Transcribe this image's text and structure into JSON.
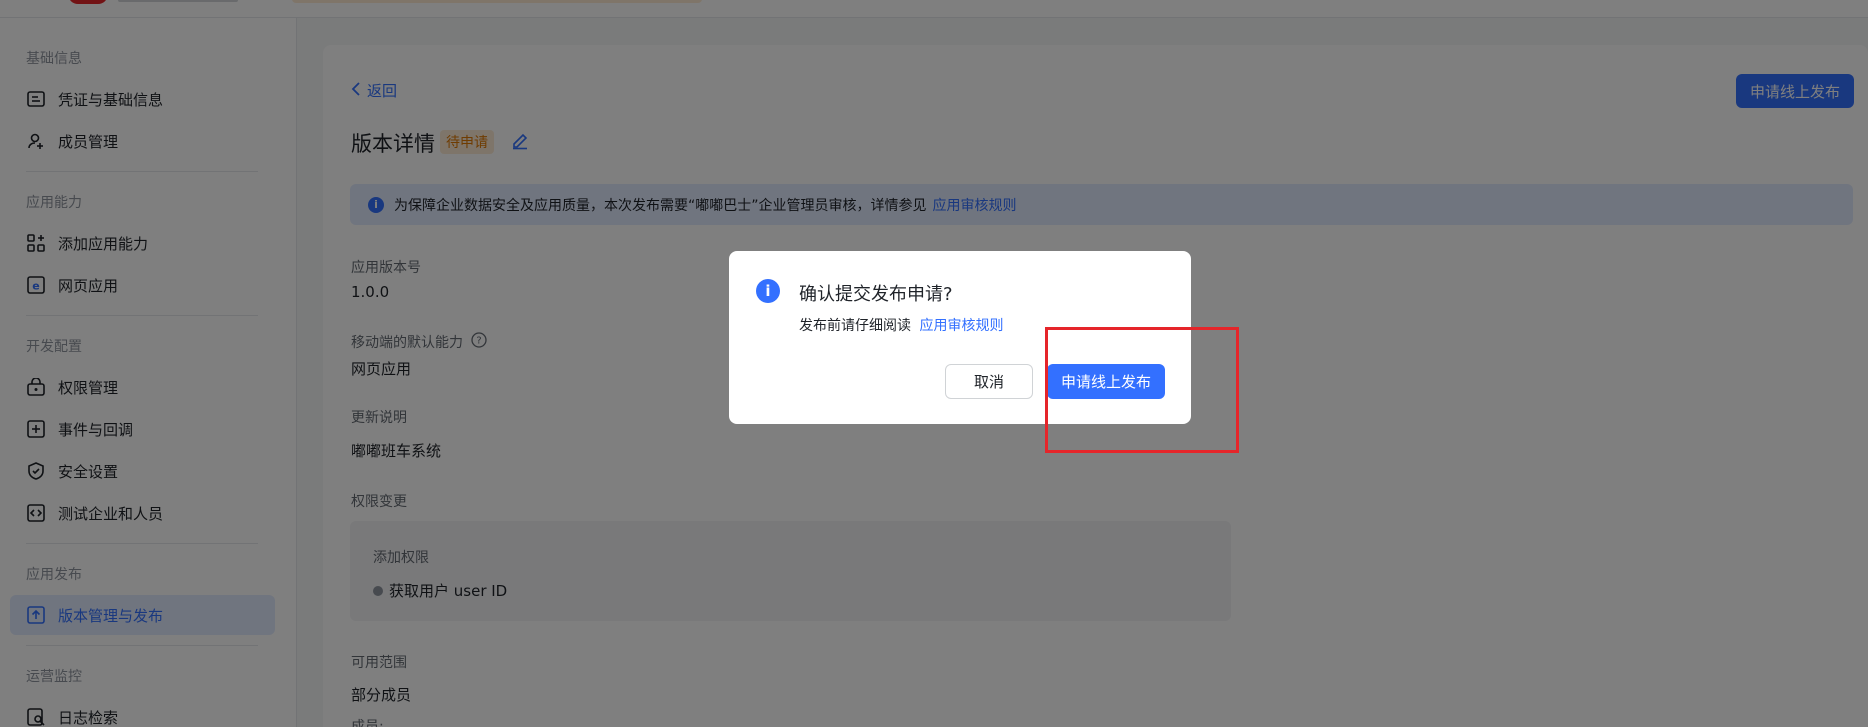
{
  "sidebar": {
    "sections": [
      {
        "title": "基础信息",
        "items": [
          {
            "label": "凭证与基础信息",
            "icon": "id-card-icon"
          },
          {
            "label": "成员管理",
            "icon": "add-user-icon"
          }
        ]
      },
      {
        "title": "应用能力",
        "items": [
          {
            "label": "添加应用能力",
            "icon": "add-grid-icon"
          },
          {
            "label": "网页应用",
            "icon": "web-app-icon"
          }
        ]
      },
      {
        "title": "开发配置",
        "items": [
          {
            "label": "权限管理",
            "icon": "lock-box-icon"
          },
          {
            "label": "事件与回调",
            "icon": "event-icon"
          },
          {
            "label": "安全设置",
            "icon": "shield-icon"
          },
          {
            "label": "测试企业和人员",
            "icon": "code-icon"
          }
        ]
      },
      {
        "title": "应用发布",
        "items": [
          {
            "label": "版本管理与发布",
            "icon": "upload-icon",
            "active": true
          }
        ]
      },
      {
        "title": "运营监控",
        "items": [
          {
            "label": "日志检索",
            "icon": "log-search-icon"
          }
        ]
      }
    ]
  },
  "main": {
    "back_label": "返回",
    "top_button_label": "申请线上发布",
    "title": "版本详情",
    "status_tag": "待申请",
    "notice": {
      "text": "为保障企业数据安全及应用质量，本次发布需要“嘟嘟巴士”企业管理员审核，详情参见",
      "link": "应用审核规则"
    },
    "fields": {
      "version_label": "应用版本号",
      "version_value": "1.0.0",
      "mobile_default_label": "移动端的默认能力",
      "mobile_default_value": "网页应用",
      "update_desc_label": "更新说明",
      "update_desc_value": "嘟嘟班车系统",
      "perm_change_label": "权限变更",
      "perm_add_title": "添加权限",
      "perm_item": "获取用户 user ID",
      "scope_label": "可用范围",
      "scope_value": "部分成员",
      "members_label": "成员:"
    }
  },
  "dialog": {
    "title": "确认提交发布申请?",
    "desc": "发布前请仔细阅读",
    "desc_link": "应用审核规则",
    "cancel_label": "取消",
    "confirm_label": "申请线上发布"
  },
  "colors": {
    "primary": "#3370ff",
    "highlight": "#e5252a",
    "tag_text": "#de7802",
    "tag_bg": "#fdebd5"
  }
}
